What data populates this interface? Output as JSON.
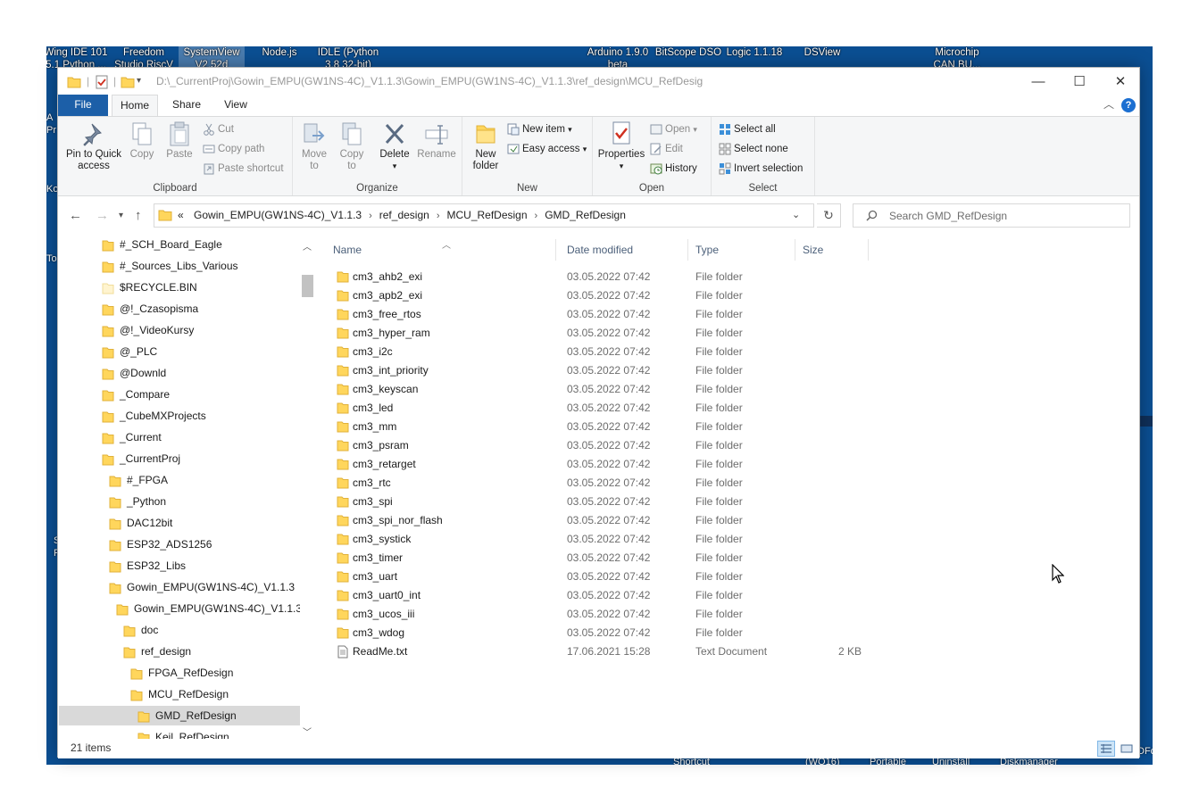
{
  "desktop": {
    "icons": [
      {
        "label": "Wing IDE 101\n5.1 Python ...",
        "selected": false
      },
      {
        "label": "Freedom\nStudio RiscV",
        "selected": false
      },
      {
        "label": "SystemView\nV2.52d",
        "selected": true
      },
      {
        "label": "Node.js",
        "selected": false
      },
      {
        "label": "IDLE (Python\n3.8 32-bit)",
        "selected": false
      },
      {
        "label": "Arduino 1.9.0\nbeta",
        "selected": false
      },
      {
        "label": "BitScope DSO",
        "selected": false
      },
      {
        "label": "Logic 1.1.18",
        "selected": false
      },
      {
        "label": "DSView",
        "selected": false
      },
      {
        "label": "Microchip\nCAN BU...",
        "selected": false
      }
    ],
    "left_fragments": [
      "A",
      "Pr",
      "Ko",
      "To",
      "S",
      "R"
    ],
    "bottom_fragments": [
      "Shortcut",
      "(WO16)",
      "Portable",
      "Uninstall",
      "Diskmanager",
      "DFc"
    ]
  },
  "window": {
    "title_path": "D:\\_CurrentProj\\Gowin_EMPU(GW1NS-4C)_V1.1.3\\Gowin_EMPU(GW1NS-4C)_V1.1.3\\ref_design\\MCU_RefDesig",
    "controls": {
      "minimize": "—",
      "maximize": "☐",
      "close": "✕"
    }
  },
  "ribbon": {
    "tabs": [
      "File",
      "Home",
      "Share",
      "View"
    ],
    "active_tab": "Home",
    "help": "?",
    "groups": {
      "clipboard": {
        "label": "Clipboard",
        "pin": "Pin to Quick\naccess",
        "copy": "Copy",
        "paste": "Paste",
        "cut": "Cut",
        "copy_path": "Copy path",
        "paste_shortcut": "Paste shortcut"
      },
      "organize": {
        "label": "Organize",
        "move_to": "Move\nto",
        "copy_to": "Copy\nto",
        "delete": "Delete",
        "rename": "Rename"
      },
      "new": {
        "label": "New",
        "new_folder": "New\nfolder",
        "new_item": "New item",
        "easy_access": "Easy access"
      },
      "open": {
        "label": "Open",
        "properties": "Properties",
        "open": "Open",
        "edit": "Edit",
        "history": "History"
      },
      "select": {
        "label": "Select",
        "select_all": "Select all",
        "select_none": "Select none",
        "invert_selection": "Invert selection"
      }
    }
  },
  "address": {
    "overflow": "«",
    "crumbs": [
      "Gowin_EMPU(GW1NS-4C)_V1.1.3",
      "ref_design",
      "MCU_RefDesign",
      "GMD_RefDesign"
    ],
    "search_placeholder": "Search GMD_RefDesign"
  },
  "navtree": [
    {
      "label": "#_SCH_Board_Eagle",
      "indent": 0,
      "selected": false,
      "light": false
    },
    {
      "label": "#_Sources_Libs_Various",
      "indent": 0,
      "selected": false,
      "light": false
    },
    {
      "label": "$RECYCLE.BIN",
      "indent": 0,
      "selected": false,
      "light": true
    },
    {
      "label": "@!_Czasopisma",
      "indent": 0,
      "selected": false,
      "light": false
    },
    {
      "label": "@!_VideoKursy",
      "indent": 0,
      "selected": false,
      "light": false
    },
    {
      "label": "@_PLC",
      "indent": 0,
      "selected": false,
      "light": false
    },
    {
      "label": "@Downld",
      "indent": 0,
      "selected": false,
      "light": false
    },
    {
      "label": "_Compare",
      "indent": 0,
      "selected": false,
      "light": false
    },
    {
      "label": "_CubeMXProjects",
      "indent": 0,
      "selected": false,
      "light": false
    },
    {
      "label": "_Current",
      "indent": 0,
      "selected": false,
      "light": false
    },
    {
      "label": "_CurrentProj",
      "indent": 0,
      "selected": false,
      "light": false
    },
    {
      "label": "#_FPGA",
      "indent": 1,
      "selected": false,
      "light": false
    },
    {
      "label": "_Python",
      "indent": 1,
      "selected": false,
      "light": false
    },
    {
      "label": "DAC12bit",
      "indent": 1,
      "selected": false,
      "light": false
    },
    {
      "label": "ESP32_ADS1256",
      "indent": 1,
      "selected": false,
      "light": false
    },
    {
      "label": "ESP32_Libs",
      "indent": 1,
      "selected": false,
      "light": false
    },
    {
      "label": "Gowin_EMPU(GW1NS-4C)_V1.1.3",
      "indent": 1,
      "selected": false,
      "light": false
    },
    {
      "label": "Gowin_EMPU(GW1NS-4C)_V1.1.3",
      "indent": 2,
      "selected": false,
      "light": false
    },
    {
      "label": "doc",
      "indent": 3,
      "selected": false,
      "light": false
    },
    {
      "label": "ref_design",
      "indent": 3,
      "selected": false,
      "light": false
    },
    {
      "label": "FPGA_RefDesign",
      "indent": 4,
      "selected": false,
      "light": false
    },
    {
      "label": "MCU_RefDesign",
      "indent": 4,
      "selected": false,
      "light": false
    },
    {
      "label": "GMD_RefDesign",
      "indent": 5,
      "selected": true,
      "light": false
    },
    {
      "label": "Keil_RefDesign",
      "indent": 5,
      "selected": false,
      "light": false
    }
  ],
  "columns": {
    "name": "Name",
    "date": "Date modified",
    "type": "Type",
    "size": "Size"
  },
  "files": [
    {
      "name": "cm3_ahb2_exi",
      "date": "03.05.2022 07:42",
      "type": "File folder",
      "size": "",
      "kind": "folder"
    },
    {
      "name": "cm3_apb2_exi",
      "date": "03.05.2022 07:42",
      "type": "File folder",
      "size": "",
      "kind": "folder"
    },
    {
      "name": "cm3_free_rtos",
      "date": "03.05.2022 07:42",
      "type": "File folder",
      "size": "",
      "kind": "folder"
    },
    {
      "name": "cm3_hyper_ram",
      "date": "03.05.2022 07:42",
      "type": "File folder",
      "size": "",
      "kind": "folder"
    },
    {
      "name": "cm3_i2c",
      "date": "03.05.2022 07:42",
      "type": "File folder",
      "size": "",
      "kind": "folder"
    },
    {
      "name": "cm3_int_priority",
      "date": "03.05.2022 07:42",
      "type": "File folder",
      "size": "",
      "kind": "folder"
    },
    {
      "name": "cm3_keyscan",
      "date": "03.05.2022 07:42",
      "type": "File folder",
      "size": "",
      "kind": "folder"
    },
    {
      "name": "cm3_led",
      "date": "03.05.2022 07:42",
      "type": "File folder",
      "size": "",
      "kind": "folder"
    },
    {
      "name": "cm3_mm",
      "date": "03.05.2022 07:42",
      "type": "File folder",
      "size": "",
      "kind": "folder"
    },
    {
      "name": "cm3_psram",
      "date": "03.05.2022 07:42",
      "type": "File folder",
      "size": "",
      "kind": "folder"
    },
    {
      "name": "cm3_retarget",
      "date": "03.05.2022 07:42",
      "type": "File folder",
      "size": "",
      "kind": "folder"
    },
    {
      "name": "cm3_rtc",
      "date": "03.05.2022 07:42",
      "type": "File folder",
      "size": "",
      "kind": "folder"
    },
    {
      "name": "cm3_spi",
      "date": "03.05.2022 07:42",
      "type": "File folder",
      "size": "",
      "kind": "folder"
    },
    {
      "name": "cm3_spi_nor_flash",
      "date": "03.05.2022 07:42",
      "type": "File folder",
      "size": "",
      "kind": "folder"
    },
    {
      "name": "cm3_systick",
      "date": "03.05.2022 07:42",
      "type": "File folder",
      "size": "",
      "kind": "folder"
    },
    {
      "name": "cm3_timer",
      "date": "03.05.2022 07:42",
      "type": "File folder",
      "size": "",
      "kind": "folder"
    },
    {
      "name": "cm3_uart",
      "date": "03.05.2022 07:42",
      "type": "File folder",
      "size": "",
      "kind": "folder"
    },
    {
      "name": "cm3_uart0_int",
      "date": "03.05.2022 07:42",
      "type": "File folder",
      "size": "",
      "kind": "folder"
    },
    {
      "name": "cm3_ucos_iii",
      "date": "03.05.2022 07:42",
      "type": "File folder",
      "size": "",
      "kind": "folder"
    },
    {
      "name": "cm3_wdog",
      "date": "03.05.2022 07:42",
      "type": "File folder",
      "size": "",
      "kind": "folder"
    },
    {
      "name": "ReadMe.txt",
      "date": "17.06.2021 15:28",
      "type": "Text Document",
      "size": "2 KB",
      "kind": "text"
    }
  ],
  "status": {
    "count": "21 items"
  },
  "colors": {
    "file_tab": "#1c5fa8",
    "folder": "#ffd65c",
    "folder_dark": "#e8b73a",
    "selected_nav": "#d9d9d9",
    "desktop": "#0b4f93"
  }
}
